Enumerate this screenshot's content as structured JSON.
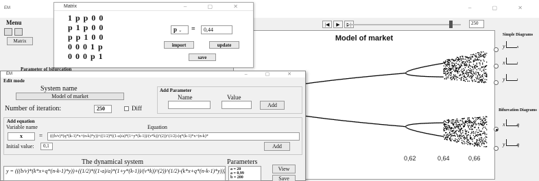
{
  "main": {
    "title": "EM",
    "menu_label": "Menu",
    "matrix_button": "Matrix",
    "bifurcation_param_label": "Parameter of bifurcation",
    "step_value": "250",
    "player": {
      "rewind": "|◀",
      "play": "▶",
      "forward": "▶|"
    }
  },
  "chart_data": {
    "type": "scatter",
    "title": "Model of market",
    "xlabel": "",
    "ylabel": "",
    "x_tick_labels": [
      "0,62",
      "0,64",
      "0,66"
    ],
    "description_points": [],
    "grid": false
  },
  "right_panel": {
    "simple_heading": "Simple Diagrams",
    "bifurcation_heading": "Bifurcation Diagrams",
    "options": [
      {
        "axis_y": "y",
        "axis_x": "x",
        "selected": false
      },
      {
        "axis_y": "x",
        "axis_x": "t",
        "selected": false
      },
      {
        "axis_y": "y",
        "axis_x": "t",
        "selected": false
      },
      {
        "axis_y": "x",
        "axis_x": "q",
        "selected": true
      },
      {
        "axis_y": "y",
        "axis_x": "q",
        "selected": false
      }
    ]
  },
  "matrix_window": {
    "title": "Matrix",
    "rows": [
      "1 p p 0 0",
      "p 1 p 0 0",
      "p p 1 0 0",
      "0 0 0 1 p",
      "0 0 0 p 1"
    ],
    "param_select": "p",
    "equals": "=",
    "param_value": "0,44",
    "import_button": "import",
    "update_button": "update",
    "save_button": "save"
  },
  "edit_window": {
    "title": "EM",
    "mode_label": "Edit mode",
    "system_name_label": "System name",
    "system_name_value": "Model of market",
    "iterations_label": "Number of iteration:",
    "iterations_value": "250",
    "diff_label": "Diff",
    "add_parameter": {
      "heading": "Add Parameter",
      "name_label": "Name",
      "value_label": "Value",
      "add_button": "Add"
    },
    "add_equation": {
      "heading": "Add equation",
      "variable_label": "Variable name",
      "equation_label": "Equation",
      "variable_value": "x",
      "equals": "=",
      "equation_value": "(((b/v)*(q*(k-1)*x+(n-k)*y))+((1/2)*((1-a)/a)*(1+y*(k-1))/(v*k))^(2))^(1/2)-(q*(k-1)*x+(n-k)*",
      "initial_label": "Initial value:",
      "initial_value": "0,1",
      "add_button": "Add"
    },
    "dynamical_system_label": "The dynamical system",
    "dynamical_system_text": "y = (((b/v)*(k*x+q*(n-k-1)*y))+((1/2)*((1-a)/a)*(1+y*(k-1))/(v*k))^(2))^(1/2)-(k*x+q*(n-k-1)*y)))/(1+",
    "parameters_label": "Parameters",
    "parameters": [
      "a = 20",
      "a = 0,99",
      "b = 200"
    ],
    "view_button": "View",
    "save_button": "Save"
  }
}
